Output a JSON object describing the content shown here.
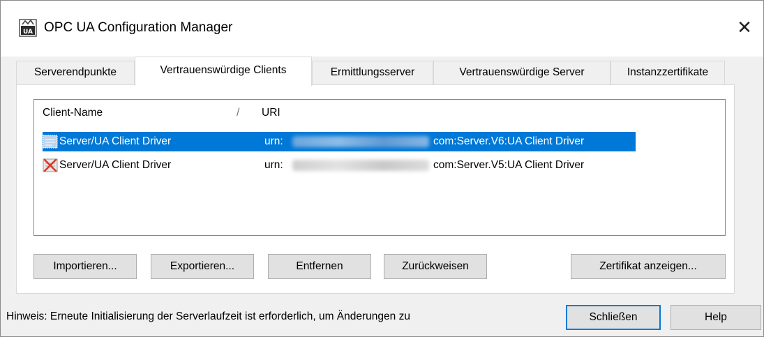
{
  "window": {
    "title": "OPC UA Configuration Manager",
    "close_glyph": "✕"
  },
  "tabs": [
    {
      "label": "Serverendpunkte",
      "active": false
    },
    {
      "label": "Vertrauenswürdige Clients",
      "active": true
    },
    {
      "label": "Ermittlungsserver",
      "active": false
    },
    {
      "label": "Vertrauenswürdige Server",
      "active": false
    },
    {
      "label": "Instanzzertifikate",
      "active": false
    }
  ],
  "list": {
    "columns": [
      {
        "label": "Client-Name",
        "sort_glyph": "/"
      },
      {
        "label": "URI"
      }
    ],
    "rows": [
      {
        "icon": "certificate-icon",
        "name": "Server/UA Client Driver",
        "uri_prefix": "urn:",
        "uri_suffix": "com:Server.V6:UA Client Driver",
        "selected": true
      },
      {
        "icon": "rejected-certificate-icon",
        "name": "Server/UA Client Driver",
        "uri_prefix": "urn:",
        "uri_suffix": "com:Server.V5:UA Client Driver",
        "selected": false
      }
    ]
  },
  "buttons": {
    "import": "Importieren...",
    "export": "Exportieren...",
    "remove": "Entfernen",
    "reject": "Zurückweisen",
    "view_certificate": "Zertifikat anzeigen...",
    "close": "Schließen",
    "help": "Help"
  },
  "hint": "Hinweis: Erneute Initialisierung der Serverlaufzeit ist erforderlich, um Änderungen zu",
  "colors": {
    "selection": "#0078d7",
    "window_bg": "#f0f0f0",
    "default_button_border": "#0078d7"
  }
}
